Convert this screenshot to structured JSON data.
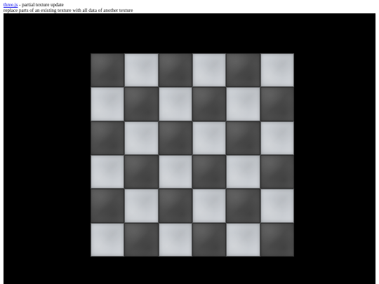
{
  "info": {
    "link_text": "three.js",
    "title_suffix": " - partial texture update",
    "description": "replace parts of an existing texture with all data of another texture"
  },
  "viewport": {
    "background": "#000000"
  },
  "texture": {
    "grid_size": 6,
    "pattern": "checkerboard",
    "dark_color": "#505050",
    "light_color": "#c8ccd1",
    "tiles": [
      [
        "dark",
        "light",
        "dark",
        "light",
        "dark",
        "light"
      ],
      [
        "light",
        "dark",
        "light",
        "dark",
        "light",
        "dark"
      ],
      [
        "dark",
        "light",
        "dark",
        "light",
        "dark",
        "light"
      ],
      [
        "light",
        "dark",
        "light",
        "dark",
        "light",
        "dark"
      ],
      [
        "dark",
        "light",
        "dark",
        "light",
        "dark",
        "light"
      ],
      [
        "light",
        "dark",
        "light",
        "dark",
        "light",
        "dark"
      ]
    ]
  }
}
